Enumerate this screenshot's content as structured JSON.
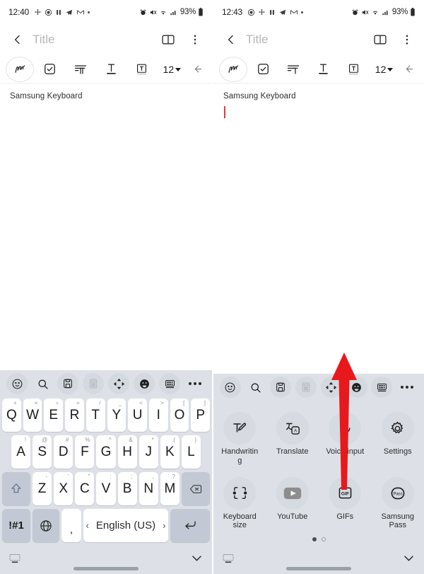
{
  "accent": {
    "red_arrow": "#e8191c",
    "caret_red": "#e0393e",
    "keyboard_bg": "#dde1e7",
    "key_bg": "#ffffff",
    "fn_key_bg": "#c2c9d4"
  },
  "left_phone": {
    "statusbar": {
      "time": "12:40",
      "battery": "93%",
      "left_icons": [
        "move-icon",
        "record-icon",
        "pause-icon",
        "telegram-icon",
        "gmail-icon",
        "more-dot-icon"
      ],
      "right_icons": [
        "alarm-icon",
        "mute-icon",
        "wifi-icon",
        "signal-icon",
        "battery-icon"
      ]
    },
    "appbar": {
      "back": "back-chevron-icon",
      "title": "Title",
      "reader": "book-icon",
      "overflow": "more-vertical-icon"
    },
    "format_toolbar": {
      "pen_label": "handwriting-pen-icon",
      "items": [
        "checkbox-icon",
        "paragraph-style-icon",
        "text-underline-icon",
        "text-box-icon"
      ],
      "font_size": "12",
      "collapse": "collapse-left-icon"
    },
    "note": {
      "text": "Samsung Keyboard",
      "caret_visible": false
    },
    "keyboard": {
      "toolbar": [
        {
          "name": "emoji-icon",
          "dim": false
        },
        {
          "name": "search-icon",
          "dim": false
        },
        {
          "name": "clipboard-icon",
          "dim": false
        },
        {
          "name": "calculator-icon",
          "dim": true
        },
        {
          "name": "keyboard-move-icon",
          "dim": false
        },
        {
          "name": "sticker-icon",
          "dim": false
        },
        {
          "name": "split-keyboard-icon",
          "dim": false
        },
        {
          "name": "more-horizontal-icon",
          "dim": false
        }
      ],
      "row1": [
        {
          "key": "Q",
          "sup": "+"
        },
        {
          "key": "W",
          "sup": "×"
        },
        {
          "key": "E",
          "sup": "÷"
        },
        {
          "key": "R",
          "sup": "="
        },
        {
          "key": "T",
          "sup": "/"
        },
        {
          "key": "Y",
          "sup": "_"
        },
        {
          "key": "U",
          "sup": "<"
        },
        {
          "key": "I",
          "sup": ">"
        },
        {
          "key": "O",
          "sup": "["
        },
        {
          "key": "P",
          "sup": "]"
        }
      ],
      "row2": [
        {
          "key": "A",
          "sup": "!"
        },
        {
          "key": "S",
          "sup": "@"
        },
        {
          "key": "D",
          "sup": "#"
        },
        {
          "key": "F",
          "sup": "%"
        },
        {
          "key": "G",
          "sup": "^"
        },
        {
          "key": "H",
          "sup": "&"
        },
        {
          "key": "J",
          "sup": "*"
        },
        {
          "key": "K",
          "sup": "("
        },
        {
          "key": "L",
          "sup": ")"
        }
      ],
      "row3_shift": "shift-icon",
      "row3": [
        {
          "key": "Z",
          "sup": "-"
        },
        {
          "key": "X",
          "sup": "'"
        },
        {
          "key": "C",
          "sup": "\""
        },
        {
          "key": "V",
          "sup": ":"
        },
        {
          "key": "B",
          "sup": ";"
        },
        {
          "key": "N",
          "sup": ","
        },
        {
          "key": "M",
          "sup": "?"
        }
      ],
      "row3_backspace": "backspace-icon",
      "row4": {
        "symbols": "!#1",
        "globe": "globe-language-icon",
        "comma": ",",
        "space_label": "English (US)",
        "space_prev": "‹",
        "space_next": "›",
        "enter": "enter-return-icon"
      },
      "nav": {
        "left": "hide-keyboard-icon",
        "right": "chevron-down-icon"
      }
    }
  },
  "right_phone": {
    "statusbar": {
      "time": "12:43",
      "battery": "93%",
      "left_icons": [
        "record-icon",
        "move-icon",
        "pause-icon",
        "telegram-icon",
        "gmail-icon",
        "more-dot-icon"
      ],
      "right_icons": [
        "alarm-icon",
        "mute-icon",
        "wifi-icon",
        "signal-icon",
        "battery-icon"
      ]
    },
    "appbar": {
      "back": "back-chevron-icon",
      "title": "Title",
      "reader": "book-icon",
      "overflow": "more-vertical-icon"
    },
    "format_toolbar": {
      "pen_label": "handwriting-pen-icon",
      "items": [
        "checkbox-icon",
        "paragraph-style-icon",
        "text-underline-icon",
        "text-box-icon"
      ],
      "font_size": "12",
      "collapse": "collapse-left-icon"
    },
    "note": {
      "text": "Samsung Keyboard",
      "caret_visible": true
    },
    "keyboard": {
      "toolbar": [
        {
          "name": "emoji-icon",
          "dim": false
        },
        {
          "name": "search-icon",
          "dim": false
        },
        {
          "name": "clipboard-icon",
          "dim": false
        },
        {
          "name": "calculator-icon",
          "dim": true
        },
        {
          "name": "keyboard-move-icon",
          "dim": false
        },
        {
          "name": "sticker-icon",
          "dim": false
        },
        {
          "name": "split-keyboard-icon",
          "dim": false
        },
        {
          "name": "more-horizontal-icon",
          "dim": false
        }
      ],
      "panel_row1": [
        {
          "label": "Handwriting",
          "icon": "handwriting-icon"
        },
        {
          "label": "Translate",
          "icon": "translate-icon"
        },
        {
          "label": "Voice input",
          "icon": "microphone-icon"
        },
        {
          "label": "Settings",
          "icon": "gear-icon"
        }
      ],
      "panel_row2": [
        {
          "label": "Keyboard size",
          "icon": "keyboard-size-icon"
        },
        {
          "label": "YouTube",
          "icon": "youtube-icon"
        },
        {
          "label": "GIFs",
          "icon": "gif-icon"
        },
        {
          "label": "Samsung Pass",
          "icon": "samsung-pass-icon"
        }
      ],
      "pager": {
        "pages": 2,
        "active": 0
      },
      "nav": {
        "left": "hide-keyboard-icon",
        "right": "chevron-down-icon"
      }
    },
    "annotation": {
      "type": "red-up-arrow",
      "points_to": "keyboard-move-icon"
    }
  }
}
